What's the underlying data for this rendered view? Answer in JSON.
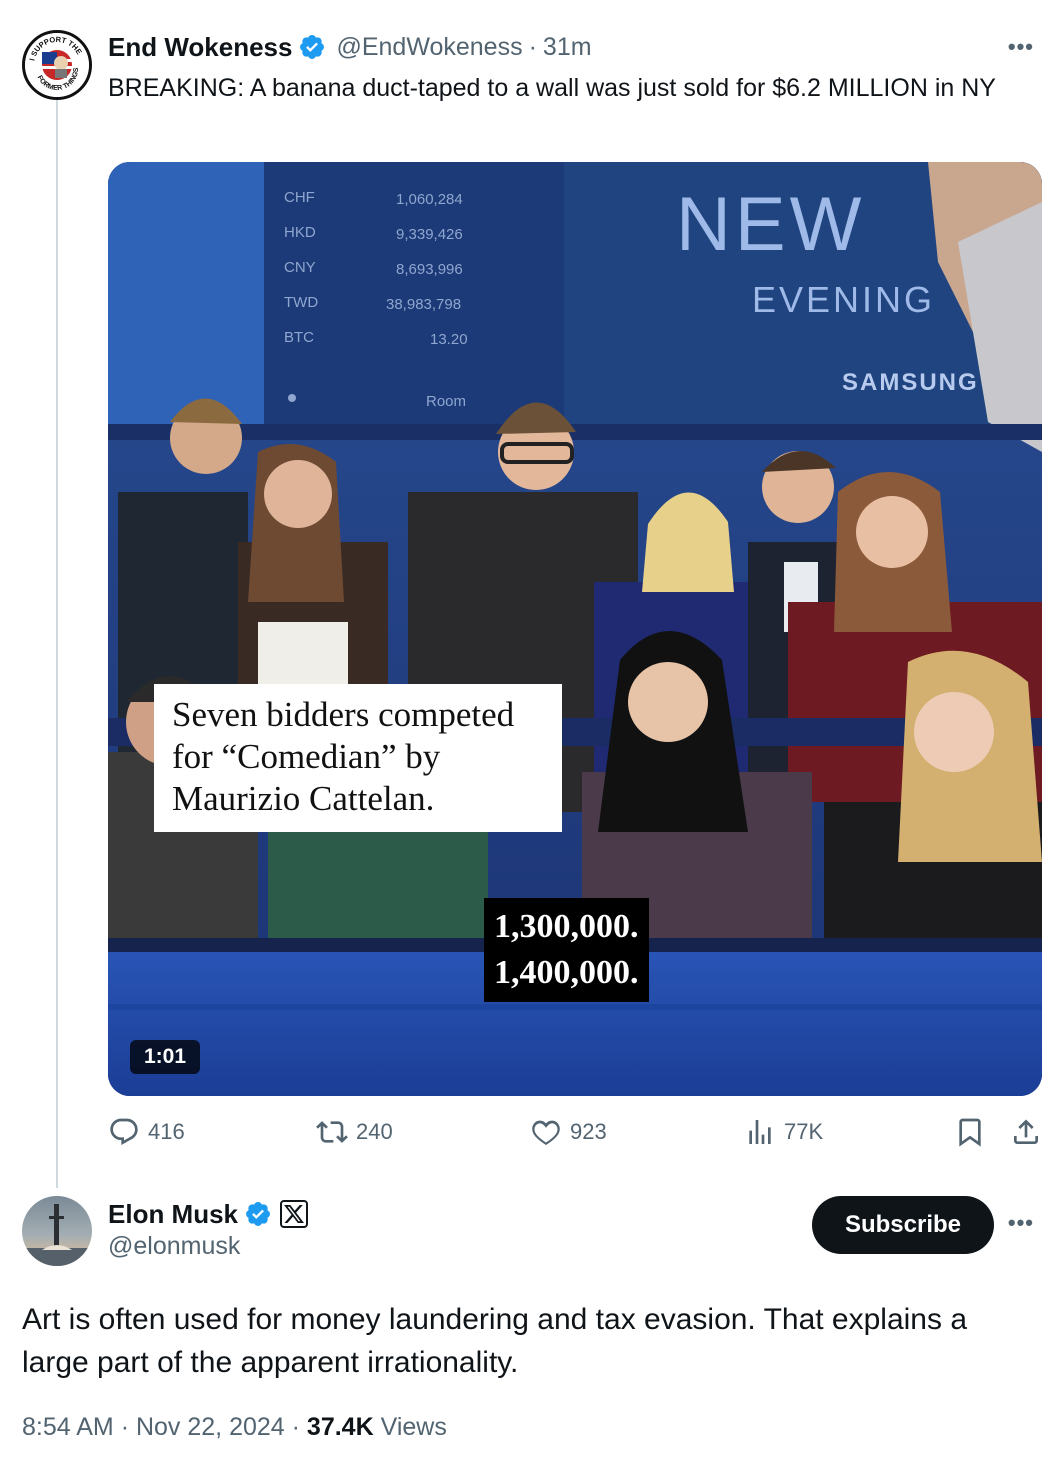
{
  "tweet1": {
    "display_name": "End Wokeness",
    "handle": "@EndWokeness",
    "time": "31m",
    "text": "BREAKING: A banana duct-taped to a wall was just sold for $6.2 MILLION in NY",
    "avatar": {
      "top_text": "I SUPPORT THE",
      "bottom_text": "FORMER THINGS"
    },
    "video": {
      "duration": "1:01",
      "board_rows": [
        {
          "code": "CHF",
          "value": "1,060,284"
        },
        {
          "code": "HKD",
          "value": "9,339,426"
        },
        {
          "code": "CNY",
          "value": "8,693,996"
        },
        {
          "code": "TWD",
          "value": "38,983,798"
        },
        {
          "code": "BTC",
          "value": "13.20"
        }
      ],
      "board_room": "Room",
      "screen_title": "NEW",
      "screen_subtitle": "EVENING",
      "screen_brand": "SAMSUNG",
      "caption_lines": [
        "Seven bidders competed",
        "for “Comedian” by",
        "Maurizio Cattelan."
      ],
      "bid_lines": [
        "1,300,000.",
        "1,400,000."
      ]
    },
    "actions": {
      "replies": "416",
      "reposts": "240",
      "likes": "923",
      "views": "77K"
    }
  },
  "tweet2": {
    "display_name": "Elon Musk",
    "handle": "@elonmusk",
    "subscribe_label": "Subscribe",
    "text": "Art is often used for money laundering and tax evasion. That explains a large part of the apparent irrationality.",
    "time": "8:54 AM",
    "date": "Nov 22, 2024",
    "views_count": "37.4K",
    "views_label": "Views"
  },
  "icons": [
    "verified-icon",
    "x-affiliate-icon",
    "more-icon",
    "reply-icon",
    "repost-icon",
    "like-icon",
    "views-icon",
    "bookmark-icon",
    "share-icon"
  ],
  "colors": {
    "verified": "#1d9bf0",
    "text": "#0f1419",
    "secondary": "#536471",
    "button": "#0f1419"
  }
}
